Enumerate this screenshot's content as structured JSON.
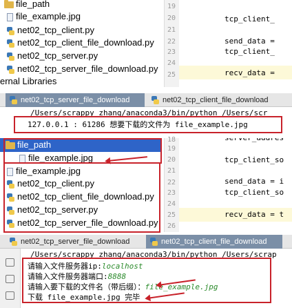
{
  "top_tree": [
    {
      "label": "file_path",
      "icon": "folder-icon"
    },
    {
      "label": "file_example.jpg",
      "icon": "file-icon"
    },
    {
      "label": "net02_tcp_client.py",
      "icon": "python-file-icon"
    },
    {
      "label": "net02_tcp_client_file_download.py",
      "icon": "python-file-icon"
    },
    {
      "label": "net02_tcp_server.py",
      "icon": "python-file-icon"
    },
    {
      "label": "net02_tcp_server_file_download.py",
      "icon": "python-file-icon"
    },
    {
      "label": "ernal Libraries",
      "icon": "library-icon"
    }
  ],
  "top_editor": {
    "line_numbers": [
      "19",
      "20",
      "21",
      "22",
      "23",
      "24",
      "25"
    ],
    "lines": [
      "",
      "tcp_client_",
      "",
      "send_data =",
      "tcp_client_",
      "",
      "recv_data ="
    ]
  },
  "tabs_1": {
    "server": "net02_tcp_server_file_download",
    "client": "net02_tcp_client_file_download"
  },
  "console_1": {
    "cmd": "/Users/scrappy_zhang/anaconda3/bin/python /Users/scr",
    "output": "127.0.0.1 : 61286 想要下载的文件为 file_example.jpg"
  },
  "mid_tree": [
    {
      "label": "file_path",
      "icon": "folder-icon"
    },
    {
      "label": "file_example.jpg",
      "icon": "file-icon"
    },
    {
      "label": "file_example.jpg",
      "icon": "file-icon"
    },
    {
      "label": "net02_tcp_client.py",
      "icon": "python-file-icon"
    },
    {
      "label": "net02_tcp_client_file_download.py",
      "icon": "python-file-icon"
    },
    {
      "label": "net02_tcp_server.py",
      "icon": "python-file-icon"
    },
    {
      "label": "net02_tcp_server_file_download.py",
      "icon": "python-file-icon"
    }
  ],
  "mid_editor": {
    "line_numbers": [
      "18",
      "19",
      "20",
      "21",
      "22",
      "23",
      "24",
      "25",
      "26"
    ],
    "lines": [
      "server_addres",
      "",
      "tcp_client_so",
      "",
      "send_data = i",
      "tcp_client_so",
      "",
      "recv_data = t",
      ""
    ]
  },
  "tabs_2": {
    "server": "net02_tcp_server_file_download",
    "client": "net02_tcp_client_file_download"
  },
  "console_2": {
    "cmd": "/Users/scrappy_zhang/anaconda3/bin/python /Users/scrap",
    "p1_label": "请输入文件服务器ip:",
    "p1_value": "localhost",
    "p2_label": "请输入文件服务器端口:",
    "p2_value": "8888",
    "p3_label": "请输入要下载的文件名（带后缀）：",
    "p3_value": "file_example.jpg",
    "done": "下载 file_example.jpg 完毕"
  },
  "colors": {
    "annotation": "#c8222a",
    "selection": "#2e64c8",
    "active_tab": "#7b8fa7"
  }
}
